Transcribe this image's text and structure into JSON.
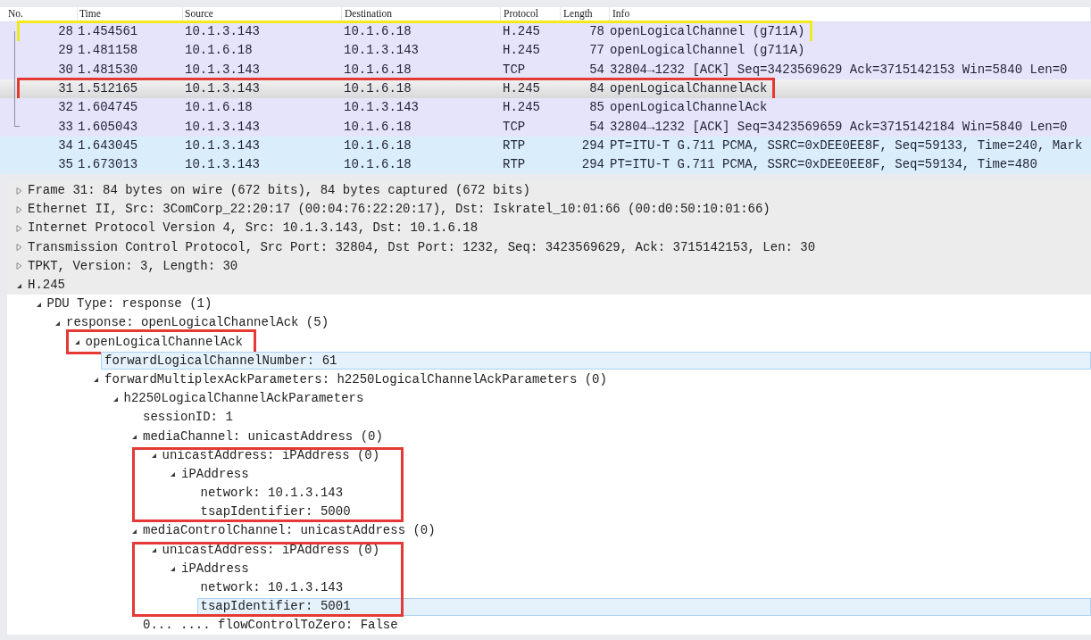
{
  "packet_list": {
    "columns": [
      "No.",
      "Time",
      "Source",
      "Destination",
      "Protocol",
      "Length",
      "Info"
    ],
    "rows": [
      {
        "no": "28",
        "time": "1.454561",
        "source": "10.1.3.143",
        "destination": "10.1.6.18",
        "protocol": "H.245",
        "length": "78",
        "info": "openLogicalChannel (g711A)",
        "color": "#e6e4fa",
        "selected": false,
        "kind": "start",
        "annotation": {
          "color": "#f2ea1c"
        }
      },
      {
        "no": "29",
        "time": "1.481158",
        "source": "10.1.6.18",
        "destination": "10.1.3.143",
        "protocol": "H.245",
        "length": "77",
        "info": "openLogicalChannel (g711A)",
        "color": "#e6e4fa",
        "selected": false,
        "kind": "middle"
      },
      {
        "no": "30",
        "time": "1.481530",
        "source": "10.1.3.143",
        "destination": "10.1.6.18",
        "protocol": "TCP",
        "length": "54",
        "info": "32804→1232 [ACK] Seq=3423569629 Ack=3715142153 Win=5840 Len=0",
        "color": "#e6e4fa",
        "selected": false,
        "kind": "middle"
      },
      {
        "no": "31",
        "time": "1.512165",
        "source": "10.1.3.143",
        "destination": "10.1.6.18",
        "protocol": "H.245",
        "length": "84",
        "info": "openLogicalChannelAck",
        "selected": true,
        "kind": "middle",
        "annotation": {
          "color": "#e53935"
        }
      },
      {
        "no": "32",
        "time": "1.604745",
        "source": "10.1.6.18",
        "destination": "10.1.3.143",
        "protocol": "H.245",
        "length": "85",
        "info": "openLogicalChannelAck",
        "color": "#e6e4fa",
        "selected": false,
        "kind": "middle"
      },
      {
        "no": "33",
        "time": "1.605043",
        "source": "10.1.3.143",
        "destination": "10.1.6.18",
        "protocol": "TCP",
        "length": "54",
        "info": "32804→1232 [ACK] Seq=3423569659 Ack=3715142184 Win=5840 Len=0",
        "color": "#e6e4fa",
        "selected": false,
        "kind": "end"
      },
      {
        "no": "34",
        "time": "1.643045",
        "source": "10.1.3.143",
        "destination": "10.1.6.18",
        "protocol": "RTP",
        "length": "294",
        "info": "PT=ITU-T G.711 PCMA, SSRC=0xDEE0EE8F, Seq=59133, Time=240, Mark",
        "color": "#daedfa",
        "selected": false,
        "kind": "single"
      },
      {
        "no": "35",
        "time": "1.673013",
        "source": "10.1.3.143",
        "destination": "10.1.6.18",
        "protocol": "RTP",
        "length": "294",
        "info": "PT=ITU-T G.711 PCMA, SSRC=0xDEE0EE8F, Seq=59134, Time=480",
        "color": "#daedfa",
        "selected": false,
        "kind": "single"
      }
    ]
  },
  "details": {
    "tree": [
      {
        "label": "Frame 31: 84 bytes on wire (672 bits), 84 bytes captured (672 bits)",
        "expanded": false,
        "selected": false
      },
      {
        "label": "Ethernet II, Src: 3ComCorp_22:20:17 (00:04:76:22:20:17), Dst: Iskratel_10:01:66 (00:d0:50:10:01:66)",
        "expanded": false,
        "selected": false
      },
      {
        "label": "Internet Protocol Version 4, Src: 10.1.3.143, Dst: 10.1.6.18",
        "expanded": false,
        "selected": false
      },
      {
        "label": "Transmission Control Protocol, Src Port: 32804, Dst Port: 1232, Seq: 3423569629, Ack: 3715142153, Len: 30",
        "expanded": false,
        "selected": false
      },
      {
        "label": "TPKT, Version: 3, Length: 30",
        "expanded": false,
        "selected": false
      },
      {
        "label": "H.245",
        "expanded": true,
        "selected": false,
        "children": [
          {
            "label": "PDU Type: response (1)",
            "expanded": true,
            "selected": false,
            "children": [
              {
                "label": "response: openLogicalChannelAck (5)",
                "expanded": true,
                "selected": false,
                "children": [
                  {
                    "label": "openLogicalChannelAck",
                    "expanded": true,
                    "selected": false,
                    "annotation": {
                      "color": "#e53935",
                      "kind": "label"
                    },
                    "children": [
                      {
                        "label": "forwardLogicalChannelNumber: 61",
                        "selected": true
                      },
                      {
                        "label": "forwardMultiplexAckParameters: h2250LogicalChannelAckParameters (0)",
                        "expanded": true,
                        "selected": false,
                        "children": [
                          {
                            "label": "h2250LogicalChannelAckParameters",
                            "expanded": true,
                            "selected": false,
                            "children": [
                              {
                                "label": "sessionID: 1",
                                "selected": false
                              },
                              {
                                "label": "mediaChannel: unicastAddress (0)",
                                "expanded": true,
                                "selected": false,
                                "children": [
                                  {
                                    "label": "unicastAddress: iPAddress (0)",
                                    "expanded": true,
                                    "selected": false,
                                    "annotation": {
                                      "color": "#e53935",
                                      "kind": "subtree"
                                    },
                                    "children": [
                                      {
                                        "label": "iPAddress",
                                        "expanded": true,
                                        "selected": false,
                                        "children": [
                                          {
                                            "label": "network: 10.1.3.143",
                                            "selected": false
                                          },
                                          {
                                            "label": "tsapIdentifier: 5000",
                                            "selected": false
                                          }
                                        ]
                                      }
                                    ]
                                  }
                                ]
                              },
                              {
                                "label": "mediaControlChannel: unicastAddress (0)",
                                "expanded": true,
                                "selected": false,
                                "children": [
                                  {
                                    "label": "unicastAddress: iPAddress (0)",
                                    "expanded": true,
                                    "selected": false,
                                    "annotation": {
                                      "color": "#e53935",
                                      "kind": "subtree"
                                    },
                                    "children": [
                                      {
                                        "label": "iPAddress",
                                        "expanded": true,
                                        "selected": false,
                                        "children": [
                                          {
                                            "label": "network: 10.1.3.143",
                                            "selected": false
                                          },
                                          {
                                            "label": "tsapIdentifier: 5001",
                                            "selected": true
                                          }
                                        ]
                                      }
                                    ]
                                  }
                                ]
                              },
                              {
                                "label": "0... .... flowControlToZero: False",
                                "selected": false
                              }
                            ]
                          }
                        ]
                      }
                    ]
                  }
                ]
              }
            ]
          }
        ]
      }
    ]
  }
}
